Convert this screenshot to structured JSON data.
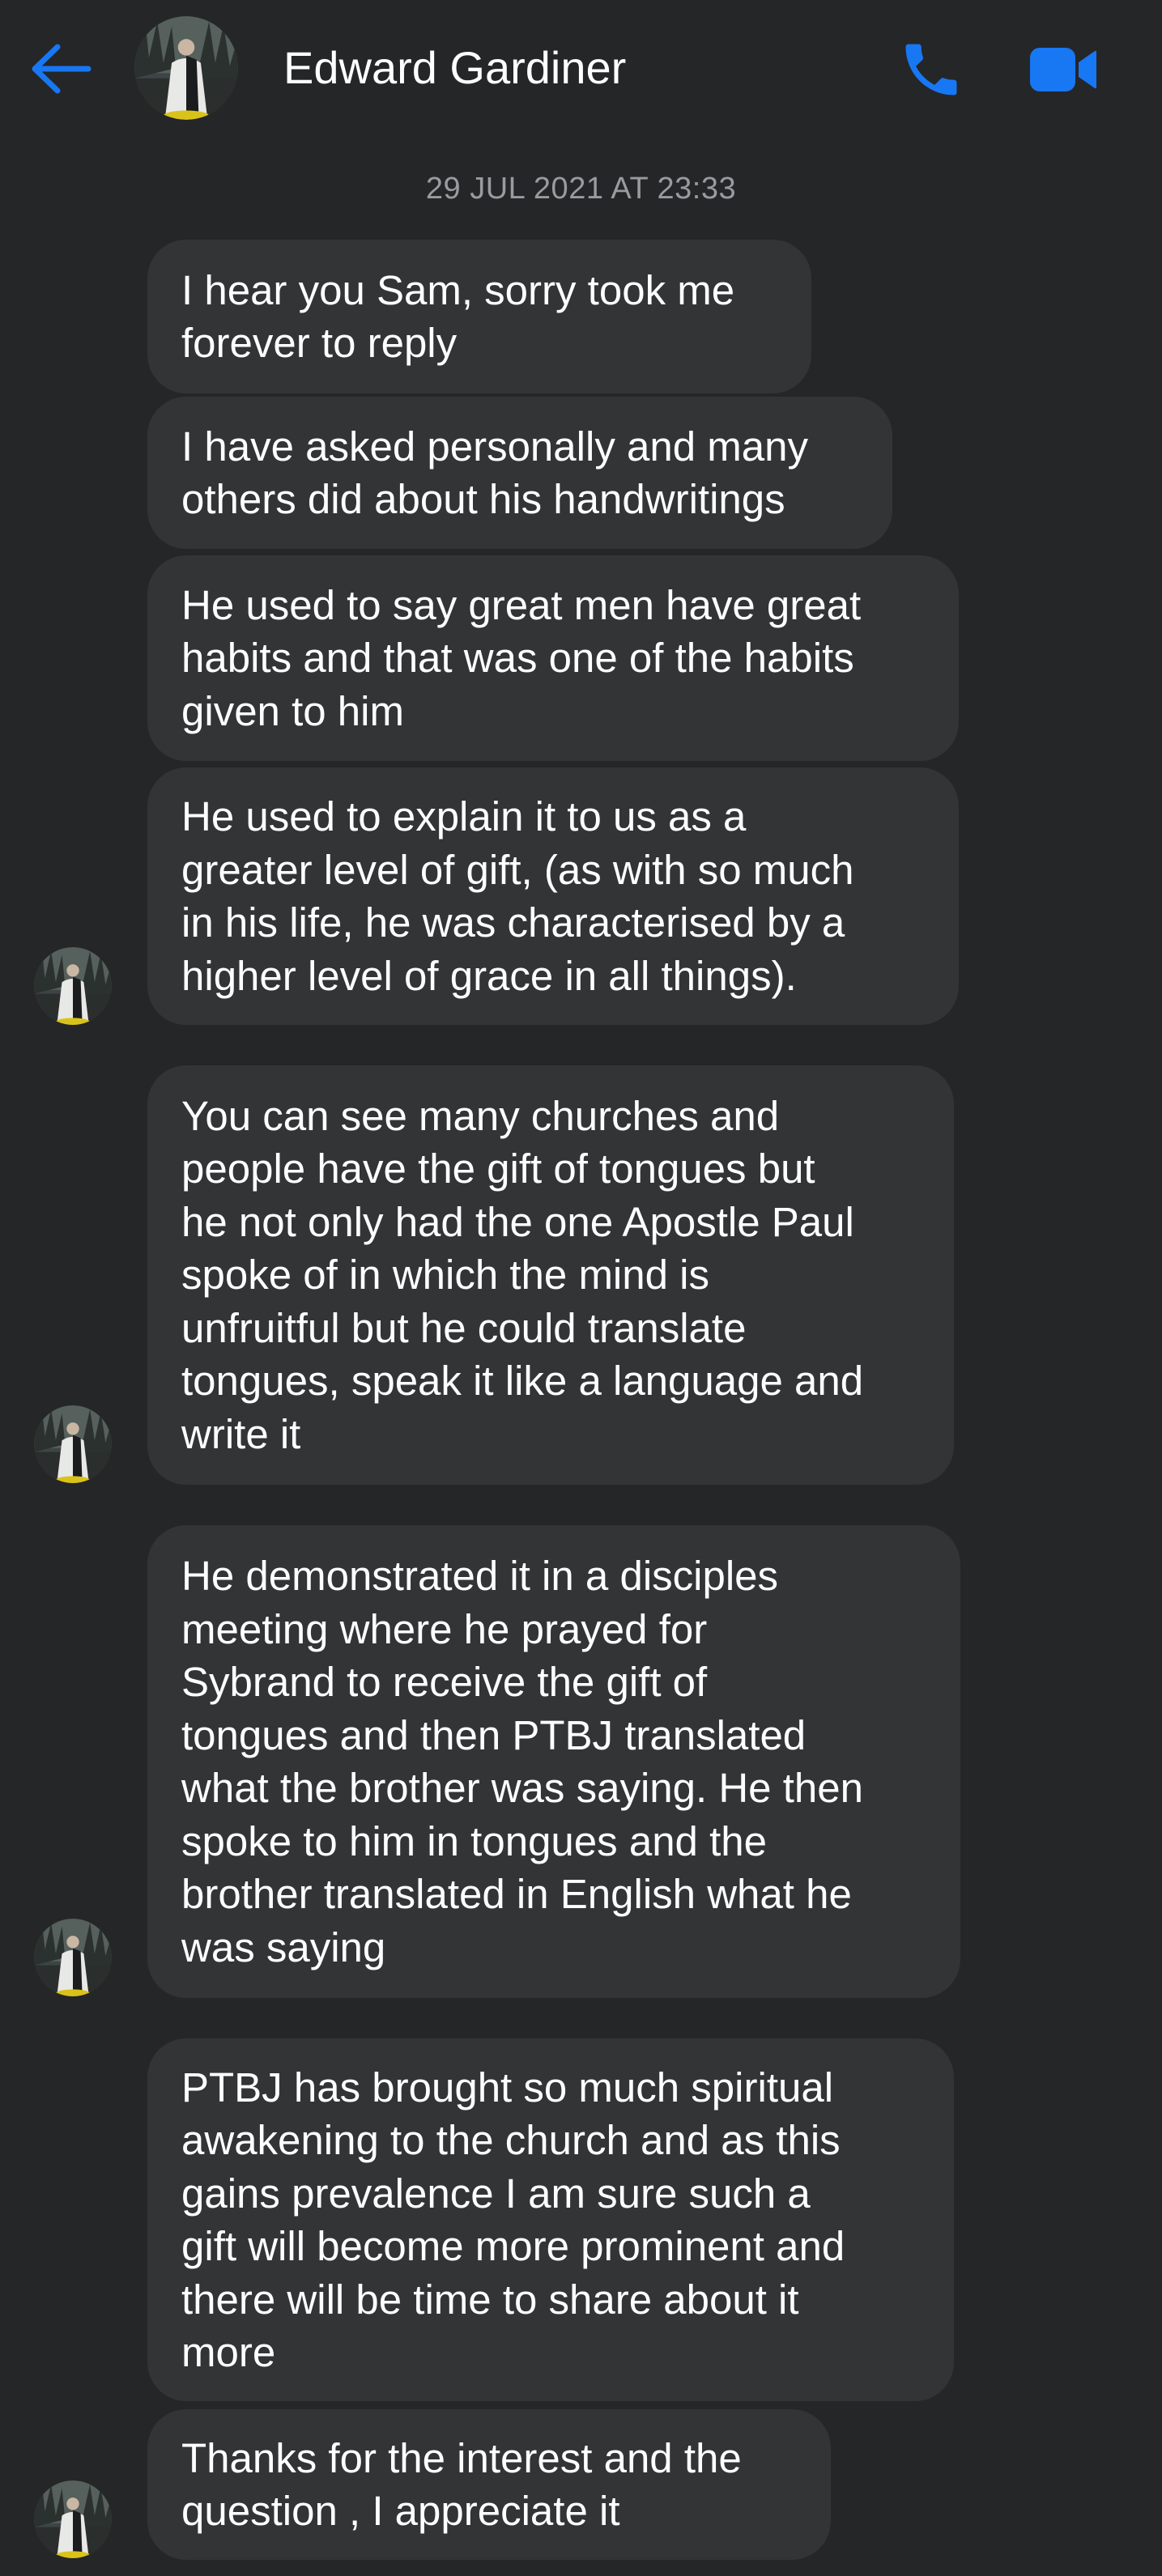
{
  "header": {
    "contact_name": "Edward Gardiner",
    "back_icon": "arrow-left-icon",
    "call_icon": "phone-icon",
    "video_icon": "video-camera-icon",
    "accent_color": "#1877f2"
  },
  "conversation": {
    "timestamp": "29 JUL 2021 AT 23:33",
    "messages": [
      {
        "text": "I hear you Sam, sorry took me\nforever to reply"
      },
      {
        "text": "I have asked personally and many\nothers did about his handwritings"
      },
      {
        "text": "He used to say great men have great\nhabits and that was one of the habits\ngiven to him"
      },
      {
        "text": "He used to explain it to us as a\ngreater level of gift, (as with so much\nin his life, he was characterised by a\nhigher level of grace in all things)."
      },
      {
        "text": "You can see many churches and\npeople have the gift of tongues but\nhe not only had the one Apostle Paul\nspoke of in which the mind is\nunfruitful but he could translate\ntongues, speak it like a language and\nwrite it"
      },
      {
        "text": "He demonstrated it in a disciples\nmeeting where he prayed for\nSybrand to receive the gift of\ntongues and then PTBJ translated\nwhat the brother was saying. He then\nspoke to him in tongues and the\nbrother translated in English what he\nwas saying"
      },
      {
        "text": "PTBJ has brought so much spiritual\nawakening to the church and as this\ngains prevalence I am sure such a\ngift will become more prominent and\nthere will be time to share about it\nmore"
      },
      {
        "text": "Thanks for the interest and the\nquestion , I appreciate it"
      }
    ]
  }
}
